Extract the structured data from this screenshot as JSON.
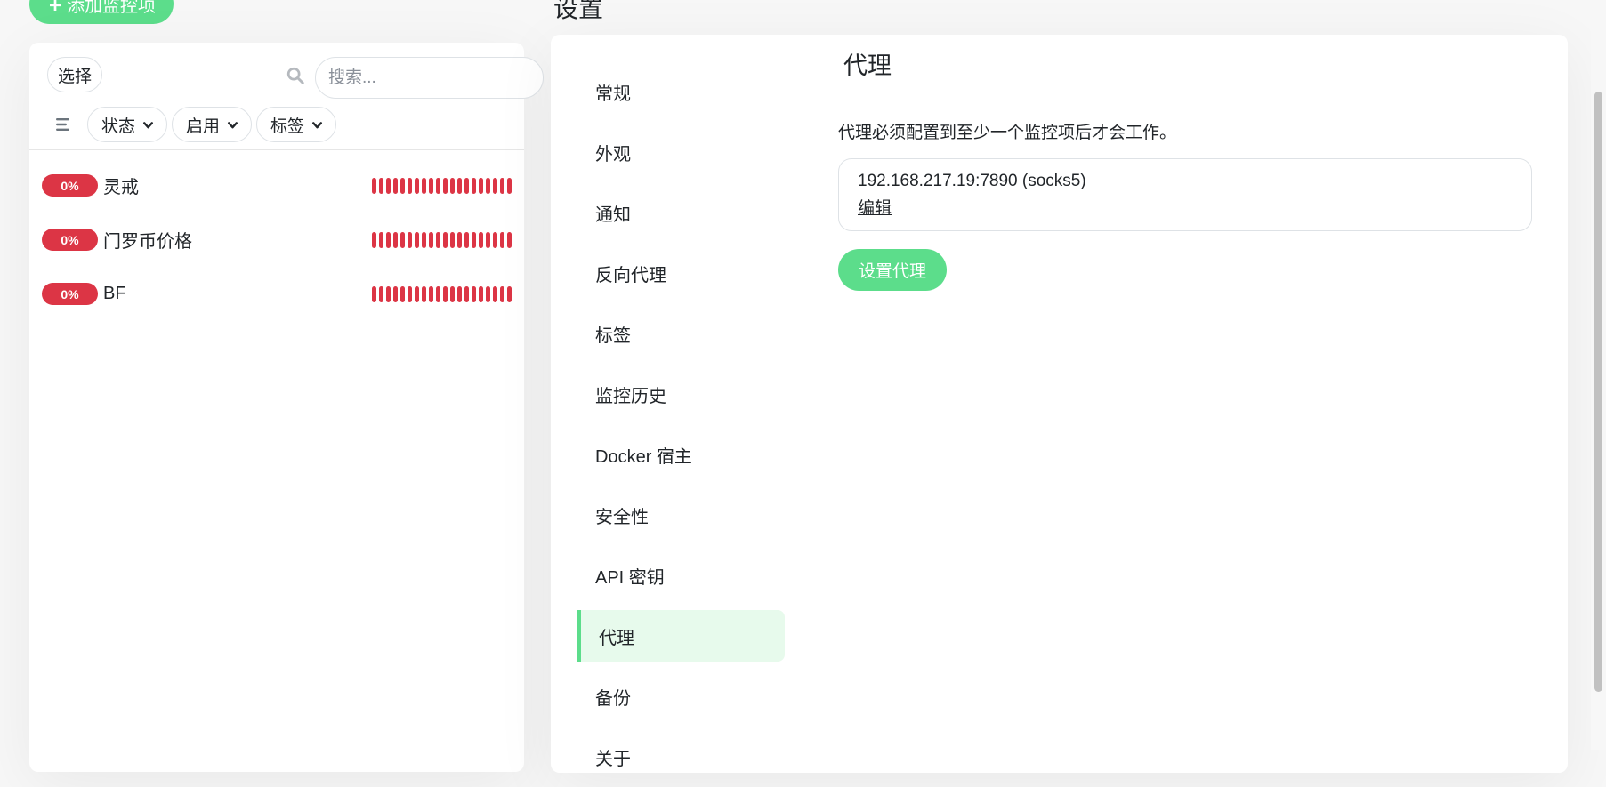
{
  "header": {
    "add_button_label": "添加监控项",
    "page_title": "设置"
  },
  "monitor_list": {
    "select_label": "选择",
    "search_placeholder": "搜索...",
    "filters": [
      {
        "label": "状态"
      },
      {
        "label": "启用"
      },
      {
        "label": "标签"
      }
    ],
    "items": [
      {
        "uptime": "0%",
        "name": "灵戒",
        "status_color": "#dc3545"
      },
      {
        "uptime": "0%",
        "name": "门罗币价格",
        "status_color": "#dc3545"
      },
      {
        "uptime": "0%",
        "name": "BF",
        "status_color": "#dc3545"
      }
    ]
  },
  "settings": {
    "menu": [
      {
        "label": "常规"
      },
      {
        "label": "外观"
      },
      {
        "label": "通知"
      },
      {
        "label": "反向代理"
      },
      {
        "label": "标签"
      },
      {
        "label": "监控历史"
      },
      {
        "label": "Docker 宿主"
      },
      {
        "label": "安全性"
      },
      {
        "label": "API 密钥"
      },
      {
        "label": "代理"
      },
      {
        "label": "备份"
      },
      {
        "label": "关于"
      }
    ],
    "active_index": 9,
    "content": {
      "title": "代理",
      "description": "代理必须配置到至少一个监控项后才会工作。",
      "proxy_address": "192.168.217.19:7890 (socks5)",
      "edit_label": "编辑",
      "setup_button_label": "设置代理"
    }
  },
  "colors": {
    "accent": "#5cdd8b",
    "danger": "#dc3545",
    "active_bg": "#e7faec"
  }
}
